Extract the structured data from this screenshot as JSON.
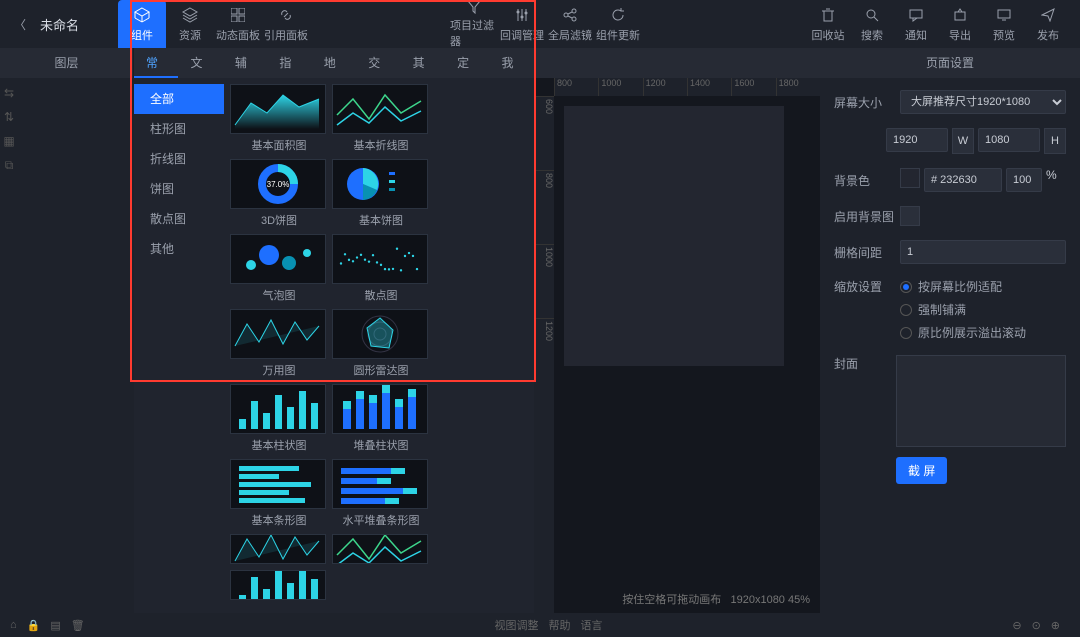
{
  "title": "未命名",
  "topbar": {
    "main_tabs": [
      {
        "label": "组件",
        "active": true
      },
      {
        "label": "资源"
      },
      {
        "label": "动态面板"
      },
      {
        "label": "引用面板"
      }
    ],
    "mid_tabs": [
      {
        "label": "项目过滤器"
      },
      {
        "label": "回调管理"
      },
      {
        "label": "全局滤镜"
      },
      {
        "label": "组件更新"
      }
    ],
    "right_tabs": [
      {
        "label": "回收站"
      },
      {
        "label": "搜索"
      },
      {
        "label": "通知"
      },
      {
        "label": "导出"
      },
      {
        "label": "预览"
      },
      {
        "label": "发布"
      }
    ]
  },
  "subbar": {
    "layer_title": "图层",
    "categories": [
      "常规",
      "文字",
      "辅助",
      "指标",
      "地图",
      "交互",
      "其他",
      "定制",
      "我的"
    ],
    "active_cat": "常规",
    "page_title": "页面设置"
  },
  "lib_side": [
    "全部",
    "柱形图",
    "折线图",
    "饼图",
    "散点图",
    "其他"
  ],
  "lib_side_active": "全部",
  "charts": [
    {
      "name": "基本面积图",
      "t": "area"
    },
    {
      "name": "基本折线图",
      "t": "line"
    },
    {
      "name": "3D饼图",
      "t": "donut"
    },
    {
      "name": "基本饼图",
      "t": "pie"
    },
    {
      "name": "气泡图",
      "t": "bubble"
    },
    {
      "name": "散点图",
      "t": "scatter"
    },
    {
      "name": "万用图",
      "t": "multi"
    },
    {
      "name": "圆形雷达图",
      "t": "radar"
    },
    {
      "name": "基本柱状图",
      "t": "bar"
    },
    {
      "name": "堆叠柱状图",
      "t": "stackbar"
    },
    {
      "name": "基本条形图",
      "t": "hbar"
    },
    {
      "name": "水平堆叠条形图",
      "t": "hstack"
    }
  ],
  "ruler_h": [
    "800",
    "1000",
    "1200",
    "1400",
    "1600",
    "1800"
  ],
  "ruler_v": [
    "600",
    "800",
    "1000",
    "1200"
  ],
  "canvas_hint": "按住空格可拖动画布",
  "canvas_size": "1920x1080 45%",
  "settings": {
    "screen_label": "屏幕大小",
    "preset": "大屏推荐尺寸1920*1080",
    "w": "1920",
    "h": "1080",
    "wl": "W",
    "hl": "H",
    "bg_label": "背景色",
    "bg_hex": "# 232630",
    "bg_pct": "100",
    "pct_unit": "%",
    "enable_bg_label": "启用背景图",
    "grid_label": "栅格间距",
    "grid_val": "1",
    "zoom_label": "缩放设置",
    "zoom_opts": [
      "按屏幕比例适配",
      "强制铺满",
      "原比例展示溢出滚动"
    ],
    "zoom_sel": 0,
    "cover_label": "封面",
    "capture": "截 屏"
  },
  "footer": {
    "view": "视图调整",
    "help": "帮助",
    "lang": "语言"
  }
}
